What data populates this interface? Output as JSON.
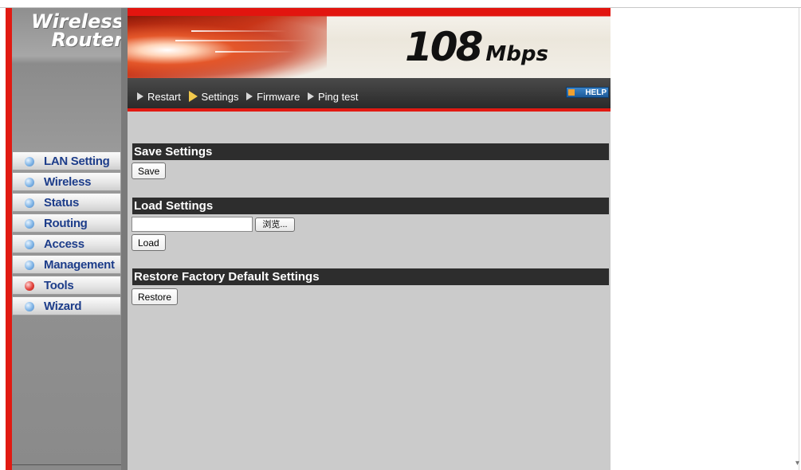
{
  "logo": {
    "line1": "Wireless",
    "line2": "Router"
  },
  "banner": {
    "speed_number": "108",
    "speed_unit": "Mbps"
  },
  "toolbar": {
    "links": [
      {
        "label": "Restart",
        "active": false
      },
      {
        "label": "Settings",
        "active": true
      },
      {
        "label": "Firmware",
        "active": false
      },
      {
        "label": "Ping test",
        "active": false
      }
    ],
    "help_label": "HELP"
  },
  "sidebar": {
    "items": [
      {
        "label": "LAN Setting",
        "active": false
      },
      {
        "label": "Wireless",
        "active": false
      },
      {
        "label": "Status",
        "active": false
      },
      {
        "label": "Routing",
        "active": false
      },
      {
        "label": "Access",
        "active": false
      },
      {
        "label": "Management",
        "active": false
      },
      {
        "label": "Tools",
        "active": true
      },
      {
        "label": "Wizard",
        "active": false
      }
    ]
  },
  "main": {
    "save": {
      "title": "Save Settings",
      "button": "Save"
    },
    "load": {
      "title": "Load Settings",
      "file_value": "",
      "browse_button": "浏览...",
      "button": "Load"
    },
    "restore": {
      "title": "Restore Factory Default Settings",
      "button": "Restore"
    }
  },
  "colors": {
    "brand_red": "#e11a12",
    "nav_text": "#1d3d8a",
    "header_bg": "#2d2d2d",
    "content_bg": "#cbcbcb"
  }
}
